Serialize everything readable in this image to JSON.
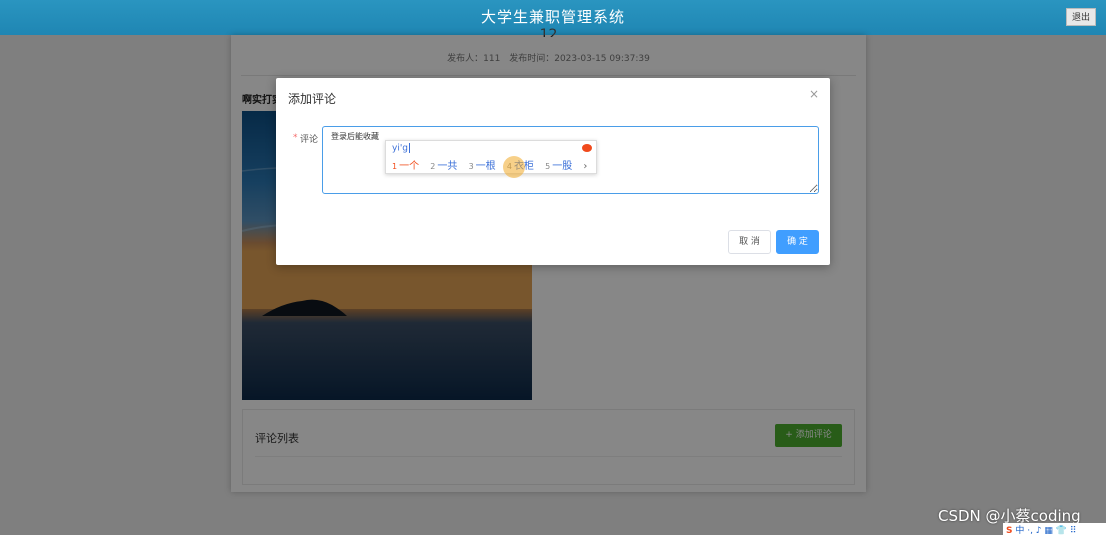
{
  "app": {
    "title": "大学生兼职管理系统",
    "logout_label": "退出"
  },
  "article": {
    "title_partial": "12",
    "publisher": "发布人：111",
    "publish_time": "发布时间：2023-03-15 09:37:39",
    "content_text": "啊实打实"
  },
  "comments": {
    "section_label": "评论列表",
    "add_button_label": "+ 添加评论"
  },
  "dialog": {
    "title": "添加评论",
    "close_glyph": "×",
    "required_mark": "*",
    "field_label": "评论",
    "textarea_value": "登录后能收藏",
    "cancel_label": "取 消",
    "confirm_label": "确 定"
  },
  "ime": {
    "typed": "yi'g",
    "candidates": [
      {
        "num": "1",
        "text": "一个"
      },
      {
        "num": "2",
        "text": "一共"
      },
      {
        "num": "3",
        "text": "一根"
      },
      {
        "num": "4",
        "text": "衣柜"
      },
      {
        "num": "5",
        "text": "一股"
      }
    ],
    "next_glyph": "›"
  },
  "overlay": {
    "watermark": "CSDN @小蔡coding",
    "tray": "中 ·, ♪ ▦ 👕 ⠿"
  },
  "colors": {
    "header": "#2a95c0",
    "primary": "#409eff",
    "success": "#4caf2f",
    "danger": "#f56c6c"
  }
}
